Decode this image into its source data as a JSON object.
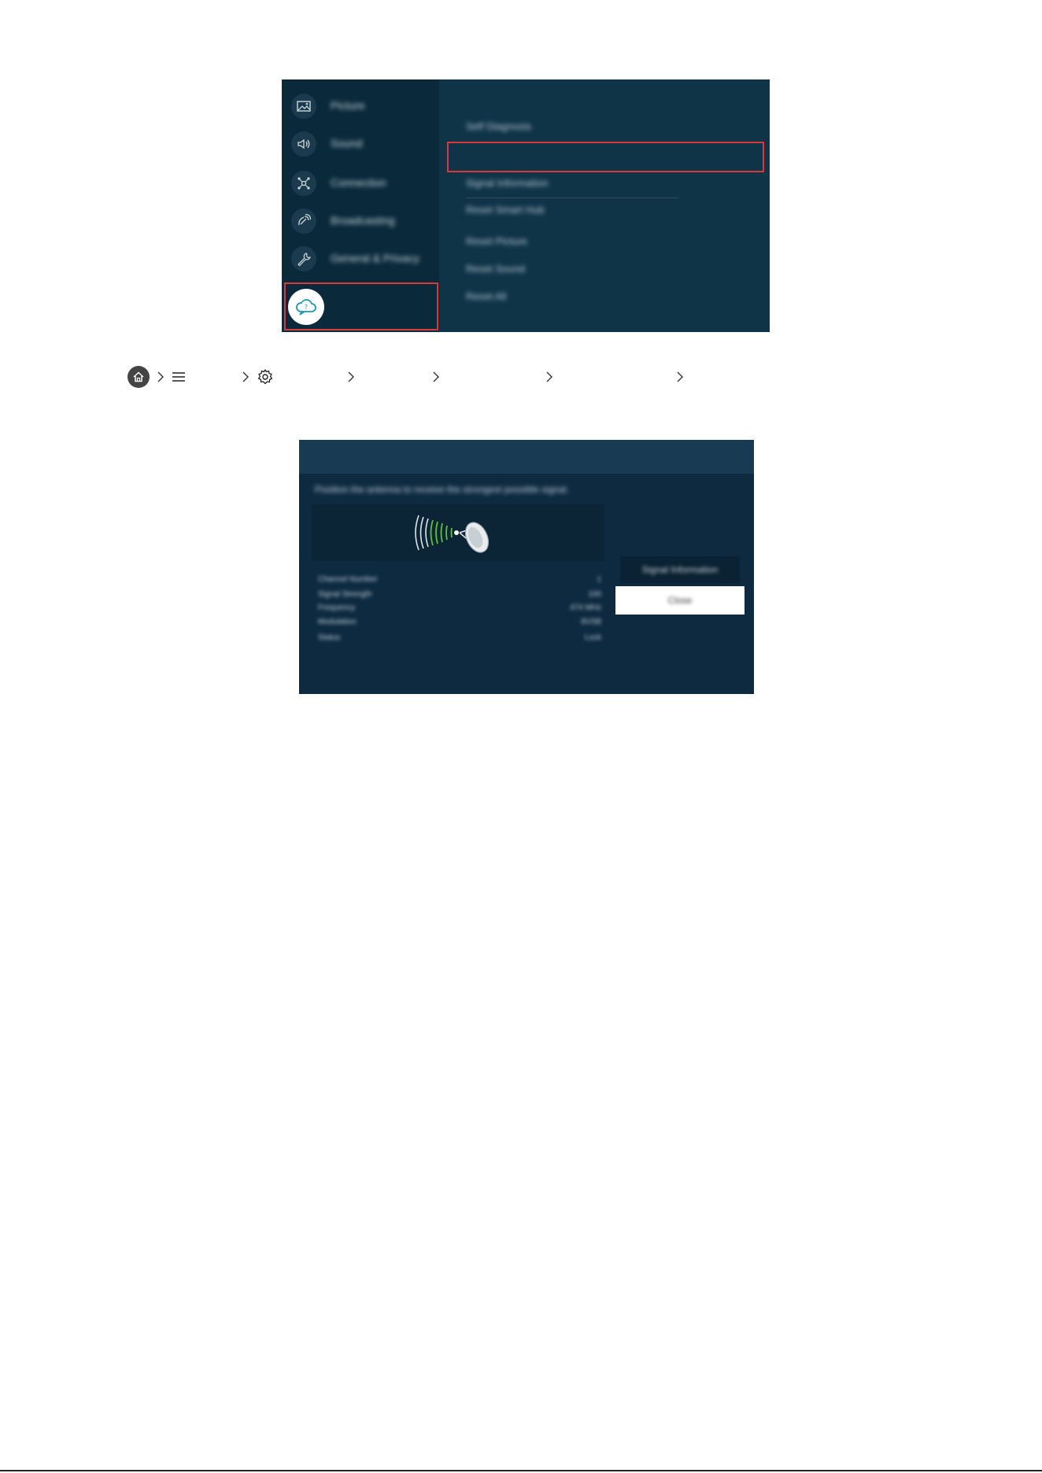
{
  "menu": {
    "left_items": [
      {
        "label": "Picture",
        "icon": "picture-icon"
      },
      {
        "label": "Sound",
        "icon": "speaker-icon"
      },
      {
        "label": "Connection",
        "icon": "network-icon"
      },
      {
        "label": "Broadcasting",
        "icon": "satellite-icon"
      },
      {
        "label": "General & Privacy",
        "icon": "wrench-icon"
      },
      {
        "label": "",
        "icon": "support-cloud-icon"
      }
    ],
    "sub_items": [
      {
        "label": "Self Diagnosis"
      },
      {
        "label": ""
      },
      {
        "label": "Signal Information"
      },
      {
        "label": "Reset Smart Hub"
      },
      {
        "label": "Reset Picture"
      },
      {
        "label": "Reset Sound"
      },
      {
        "label": "Reset All"
      }
    ]
  },
  "breadcrumb": {
    "items": [
      "",
      "",
      "",
      "",
      "",
      ""
    ]
  },
  "signal": {
    "title": "",
    "description": "Position the antenna to receive the strongest possible signal.",
    "stats": [
      {
        "label": "Channel Number",
        "value": "1"
      },
      {
        "label": "Signal Strength",
        "value": "100"
      },
      {
        "label": "Frequency",
        "value": "474 MHz"
      },
      {
        "label": "Modulation",
        "value": "8VSB"
      },
      {
        "label": "Status",
        "value": "Lock"
      }
    ],
    "buttons": {
      "signal_info": "Signal Information",
      "close": "Close"
    }
  },
  "colors": {
    "highlight": "#d83a3a",
    "signal_green": "#5fbf3a",
    "panel_bg": "#0d3045"
  }
}
